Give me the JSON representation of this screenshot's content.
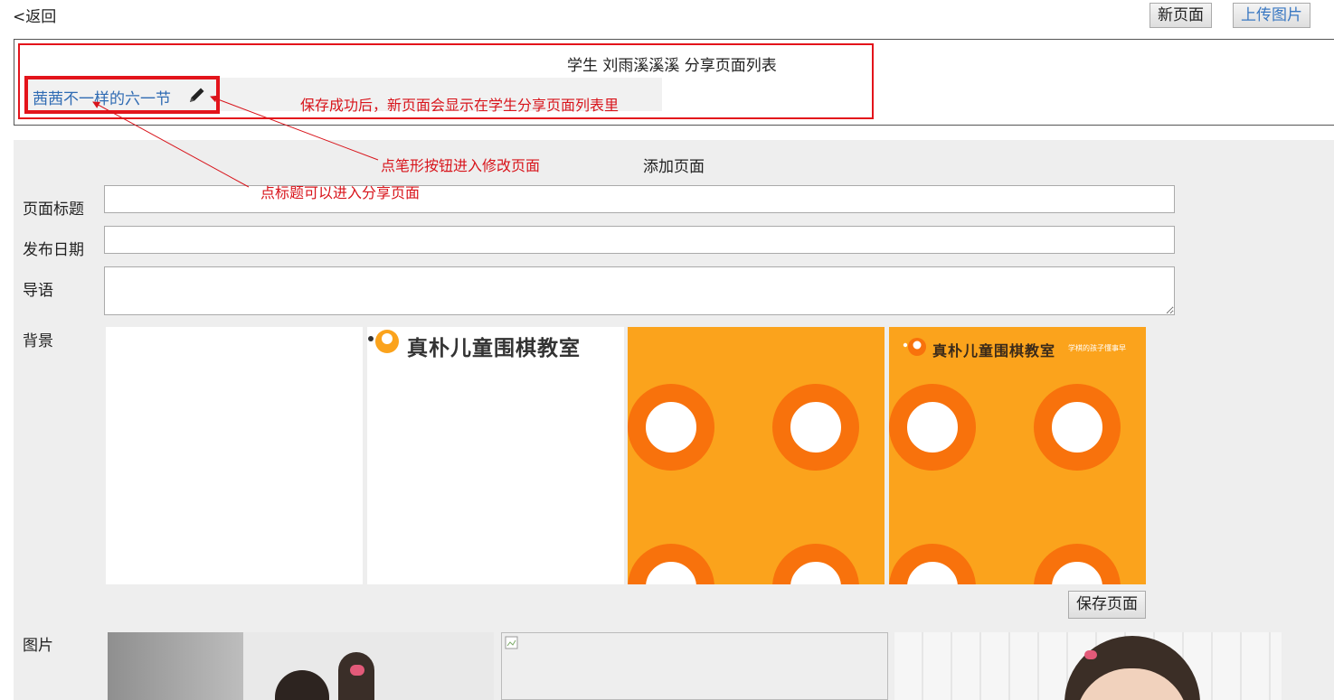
{
  "nav": {
    "back_label": "<返回"
  },
  "toolbar": {
    "new_page_label": "新页面",
    "upload_label": "上传图片"
  },
  "share_list": {
    "title": "学生 刘雨溪溪溪 分享页面列表",
    "items": [
      {
        "title": "茜茜不一样的六一节",
        "edit_icon": "pencil-icon"
      }
    ]
  },
  "annotations": {
    "save_note": "保存成功后，新页面会显示在学生分享页面列表里",
    "pencil_note": "点笔形按钮进入修改页面",
    "title_note": "点标题可以进入分享页面"
  },
  "form": {
    "heading": "添加页面",
    "title_label": "页面标题",
    "title_value": "",
    "date_label": "发布日期",
    "date_value": "",
    "intro_label": "导语",
    "intro_value": "",
    "background_label": "背景",
    "backgrounds": [
      {
        "name": "blank-white"
      },
      {
        "name": "logo-white",
        "logo_text": "真朴儿童围棋教室"
      },
      {
        "name": "orange-circles"
      },
      {
        "name": "orange-logo-circles",
        "logo_text": "真朴儿童围棋教室",
        "slogan": "学棋的孩子懂事早"
      }
    ],
    "save_label": "保存页面",
    "images_label": "图片"
  },
  "colors": {
    "annotation_red": "#e3141b",
    "brand_orange": "#fba31c",
    "ring_orange": "#f8720c",
    "link_blue": "#2f6bb3"
  }
}
